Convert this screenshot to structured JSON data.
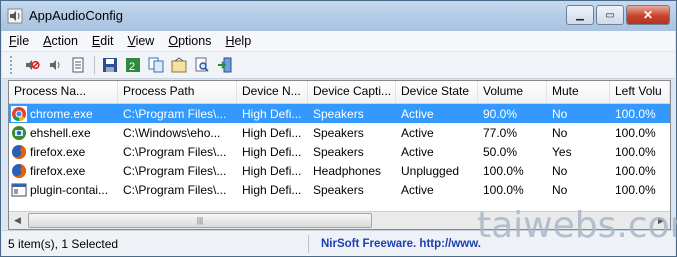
{
  "window": {
    "title": "AppAudioConfig"
  },
  "menu": [
    {
      "label": "File",
      "key": "F",
      "rest": "ile"
    },
    {
      "label": "Action",
      "key": "A",
      "rest": "ction"
    },
    {
      "label": "Edit",
      "key": "E",
      "rest": "dit"
    },
    {
      "label": "View",
      "key": "V",
      "rest": "iew"
    },
    {
      "label": "Options",
      "key": "O",
      "rest": "ptions"
    },
    {
      "label": "Help",
      "key": "H",
      "rest": "elp"
    }
  ],
  "toolbar": [
    "mute-icon",
    "unmute-icon",
    "properties-icon",
    "save-icon",
    "export-icon",
    "copy-icon",
    "html-report-icon",
    "find-icon",
    "exit-icon"
  ],
  "columns": [
    "Process Na...",
    "Process Path",
    "Device N...",
    "Device Capti...",
    "Device State",
    "Volume",
    "Mute",
    "Left Volu"
  ],
  "rows": [
    {
      "icon": "chrome-icon",
      "cells": [
        "chrome.exe",
        "C:\\Program Files\\...",
        "High Defi...",
        "Speakers",
        "Active",
        "90.0%",
        "No",
        "100.0%"
      ],
      "selected": true
    },
    {
      "icon": "ehshell-icon",
      "cells": [
        "ehshell.exe",
        "C:\\Windows\\eho...",
        "High Defi...",
        "Speakers",
        "Active",
        "77.0%",
        "No",
        "100.0%"
      ],
      "selected": false
    },
    {
      "icon": "firefox-icon",
      "cells": [
        "firefox.exe",
        "C:\\Program Files\\...",
        "High Defi...",
        "Speakers",
        "Active",
        "50.0%",
        "Yes",
        "100.0%"
      ],
      "selected": false
    },
    {
      "icon": "firefox-icon",
      "cells": [
        "firefox.exe",
        "C:\\Program Files\\...",
        "High Defi...",
        "Headphones",
        "Unplugged",
        "100.0%",
        "No",
        "100.0%"
      ],
      "selected": false
    },
    {
      "icon": "plugin-icon",
      "cells": [
        "plugin-contai...",
        "C:\\Program Files\\...",
        "High Defi...",
        "Speakers",
        "Active",
        "100.0%",
        "No",
        "100.0%"
      ],
      "selected": false
    }
  ],
  "status": {
    "left": "5 item(s), 1 Selected",
    "right": "NirSoft Freeware.  http://www."
  },
  "watermark": "taiwebs.com"
}
